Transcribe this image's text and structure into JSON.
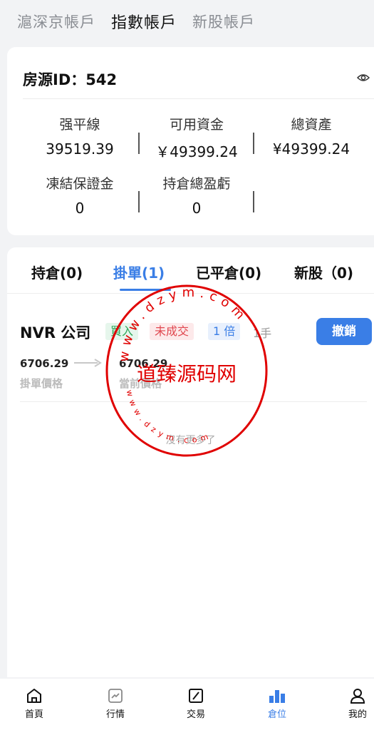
{
  "top_tabs": [
    {
      "label": "滬深京帳戶",
      "active": false
    },
    {
      "label": "指數帳戶",
      "active": true
    },
    {
      "label": "新股帳戶",
      "active": false
    }
  ],
  "account": {
    "title": "房源ID：542",
    "stats": [
      {
        "label": "强平線",
        "value": "39519.39"
      },
      {
        "label": "可用資金",
        "value": "￥49399.24"
      },
      {
        "label": "總資產",
        "value": "¥49399.24"
      },
      {
        "label": "凍結保證金",
        "value": "0"
      },
      {
        "label": "持倉總盈虧",
        "value": "0"
      }
    ]
  },
  "position_tabs": [
    {
      "label": "持倉(0)",
      "active": false
    },
    {
      "label": "掛單(1)",
      "active": true
    },
    {
      "label": "已平倉(0)",
      "active": false
    },
    {
      "label": "新股（0)",
      "active": false
    }
  ],
  "order": {
    "name": "NVR 公司",
    "side": "買入",
    "status": "未成交",
    "leverage": "1 倍",
    "lot": "1手",
    "cancel_label": "撤銷",
    "order_price": "6706.29",
    "order_price_label": "掛單價格",
    "current_price": "6706.29",
    "current_price_label": "當前價格"
  },
  "no_more": "沒有更多了",
  "watermark": {
    "text": "道臻源码网",
    "url_top": "www.dzym.com",
    "url_bottom": "www.dzym.com",
    "color": "#e00000"
  },
  "bottom_nav": [
    {
      "label": "首頁",
      "icon": "home-icon",
      "active": false
    },
    {
      "label": "行情",
      "icon": "chart-icon",
      "active": false
    },
    {
      "label": "交易",
      "icon": "trade-icon",
      "active": false
    },
    {
      "label": "倉位",
      "icon": "bar-chart-icon",
      "active": true
    },
    {
      "label": "我的",
      "icon": "user-icon",
      "active": false
    }
  ],
  "colors": {
    "accent": "#3a7ee6",
    "buy": "#2fa85a",
    "sell": "#e0474f"
  }
}
